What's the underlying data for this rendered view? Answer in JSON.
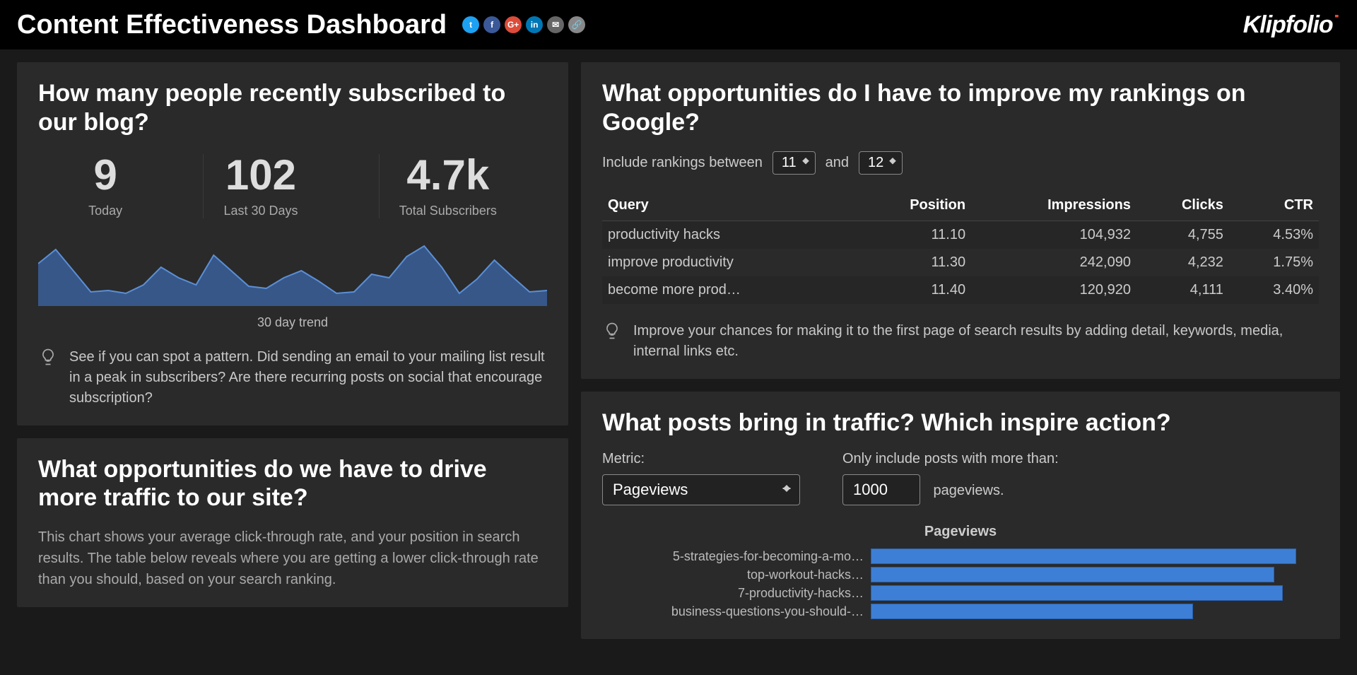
{
  "header": {
    "title": "Content Effectiveness Dashboard",
    "logo_main": "Klipfolio",
    "logo_accent": "˙",
    "share": [
      "twitter",
      "facebook",
      "google-plus",
      "linkedin",
      "email",
      "link"
    ]
  },
  "subs_panel": {
    "title": "How many people recently subscribed to our blog?",
    "stats": [
      {
        "value": "9",
        "label": "Today"
      },
      {
        "value": "102",
        "label": "Last 30 Days"
      },
      {
        "value": "4.7k",
        "label": "Total Subscribers"
      }
    ],
    "spark_caption": "30 day trend",
    "tip": "See if you can spot a pattern. Did sending an email to your mailing list result in a peak in subscribers? Are there recurring posts on social that encourage subscription?"
  },
  "traffic_panel": {
    "title": "What opportunities do we have to drive more traffic to our site?",
    "desc": "This chart shows your average click-through rate, and your position in search results. The table below reveals where you are getting a lower click-through rate than you should, based on your search ranking."
  },
  "rank_panel": {
    "title": "What opportunities do I have to improve my rankings on Google?",
    "filter_prefix": "Include rankings between",
    "filter_from": "11",
    "filter_and": "and",
    "filter_to": "12",
    "cols": [
      "Query",
      "Position",
      "Impressions",
      "Clicks",
      "CTR"
    ],
    "rows": [
      {
        "query": "productivity hacks",
        "position": "11.10",
        "impressions": "104,932",
        "clicks": "4,755",
        "ctr": "4.53%"
      },
      {
        "query": "improve productivity",
        "position": "11.30",
        "impressions": "242,090",
        "clicks": "4,232",
        "ctr": "1.75%"
      },
      {
        "query": "become more prod…",
        "position": "11.40",
        "impressions": "120,920",
        "clicks": "4,111",
        "ctr": "3.40%"
      }
    ],
    "tip": "Improve your chances for making it to the first page of search results by adding detail, keywords, media, internal links etc."
  },
  "posts_panel": {
    "title": "What posts bring in traffic? Which inspire action?",
    "metric_label": "Metric:",
    "metric_value": "Pageviews",
    "threshold_label": "Only include posts with more than:",
    "threshold_value": "1000",
    "threshold_suffix": "pageviews.",
    "chart_title": "Pageviews"
  },
  "chart_data": [
    {
      "type": "area",
      "title": "30 day trend",
      "x": [
        1,
        2,
        3,
        4,
        5,
        6,
        7,
        8,
        9,
        10,
        11,
        12,
        13,
        14,
        15,
        16,
        17,
        18,
        19,
        20,
        21,
        22,
        23,
        24,
        25,
        26,
        27,
        28,
        29,
        30
      ],
      "values": [
        60,
        80,
        50,
        20,
        22,
        18,
        30,
        55,
        40,
        30,
        72,
        50,
        28,
        25,
        40,
        50,
        35,
        18,
        20,
        45,
        40,
        70,
        85,
        55,
        18,
        38,
        65,
        42,
        20,
        22
      ],
      "ylim": [
        0,
        100
      ]
    },
    {
      "type": "bar",
      "title": "Pageviews",
      "orientation": "horizontal",
      "categories": [
        "5-strategies-for-becoming-a-mo…",
        "top-workout-hacks…",
        "7-productivity-hacks…",
        "business-questions-you-should-…"
      ],
      "values": [
        95,
        90,
        92,
        72
      ],
      "ylim": [
        0,
        100
      ]
    }
  ]
}
